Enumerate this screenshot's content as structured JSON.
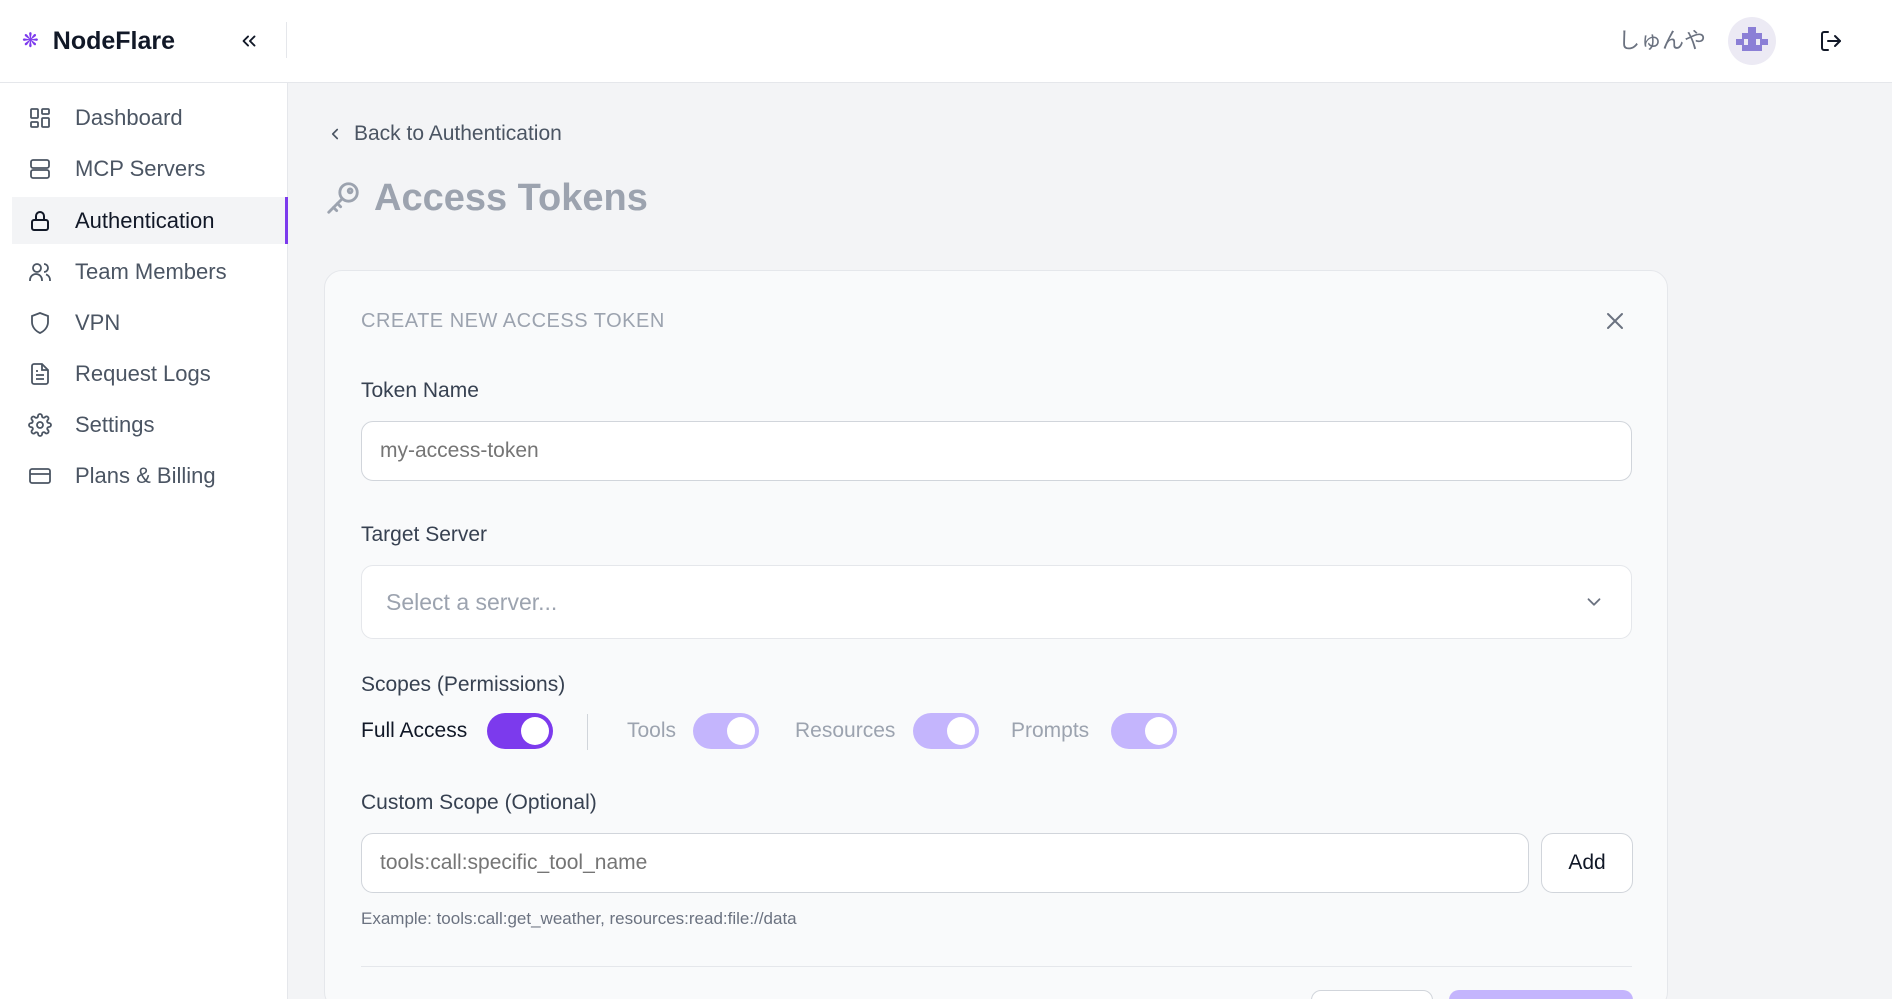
{
  "app": {
    "name": "NodeFlare",
    "accent": "#7c3aed"
  },
  "header": {
    "user_name": "しゅんや"
  },
  "sidebar": {
    "items": [
      {
        "label": "Dashboard",
        "icon": "dashboard-icon",
        "active": false
      },
      {
        "label": "MCP Servers",
        "icon": "server-icon",
        "active": false
      },
      {
        "label": "Authentication",
        "icon": "lock-icon",
        "active": true
      },
      {
        "label": "Team Members",
        "icon": "users-icon",
        "active": false
      },
      {
        "label": "VPN",
        "icon": "shield-icon",
        "active": false
      },
      {
        "label": "Request Logs",
        "icon": "document-icon",
        "active": false
      },
      {
        "label": "Settings",
        "icon": "gear-icon",
        "active": false
      },
      {
        "label": "Plans & Billing",
        "icon": "credit-card-icon",
        "active": false
      }
    ]
  },
  "main": {
    "back_label": "Back to Authentication",
    "page_title": "Access Tokens",
    "form": {
      "title": "CREATE NEW ACCESS TOKEN",
      "token_name_label": "Token Name",
      "token_name_placeholder": "my-access-token",
      "target_server_label": "Target Server",
      "target_server_placeholder": "Select a server...",
      "scopes_label": "Scopes (Permissions)",
      "scopes": [
        {
          "label": "Full Access",
          "enabled": true,
          "disabled": false
        },
        {
          "label": "Tools",
          "enabled": true,
          "disabled": true
        },
        {
          "label": "Resources",
          "enabled": true,
          "disabled": true
        },
        {
          "label": "Prompts",
          "enabled": true,
          "disabled": true
        }
      ],
      "custom_scope_label": "Custom Scope (Optional)",
      "custom_scope_placeholder": "tools:call:specific_tool_name",
      "add_label": "Add",
      "helper_text": "Example: tools:call:get_weather, resources:read:file://data"
    }
  }
}
